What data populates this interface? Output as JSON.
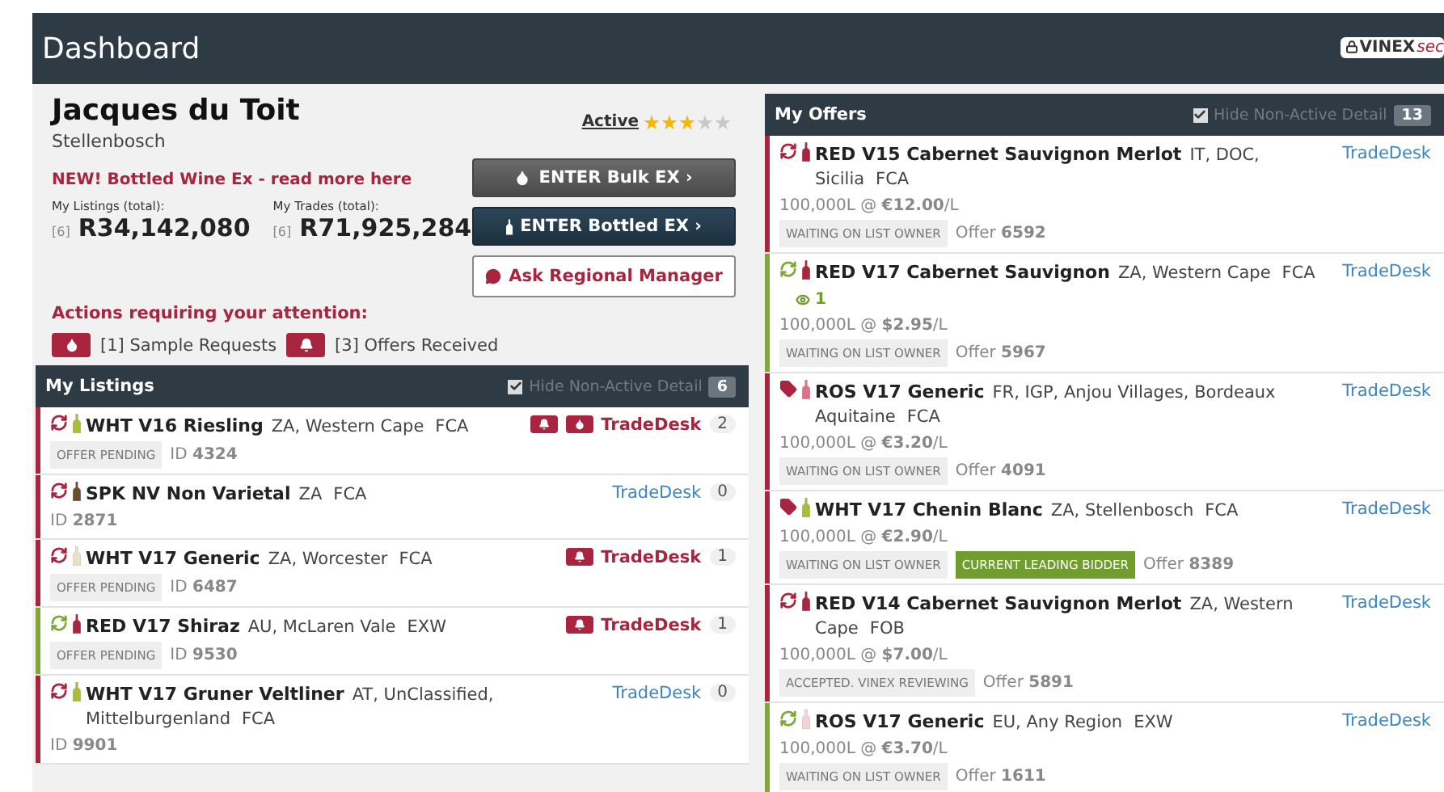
{
  "header": {
    "title": "Dashboard",
    "badge": {
      "brand": "VINEX",
      "suffix": "sec"
    }
  },
  "profile": {
    "name": "Jacques du Toit",
    "location": "Stellenbosch",
    "status": "Active",
    "stars": 3,
    "news": "NEW! Bottled Wine Ex - read more here",
    "stats": [
      {
        "label": "My Listings (total):",
        "count": "[6]",
        "value": "R34,142,080"
      },
      {
        "label": "My Trades (total):",
        "count": "[6]",
        "value": "R71,925,284"
      }
    ],
    "buttons": [
      {
        "kind": "bulk",
        "label": "ENTER Bulk EX ›"
      },
      {
        "kind": "bottled",
        "label": "ENTER Bottled EX ›"
      },
      {
        "kind": "ask",
        "label": "Ask Regional Manager"
      }
    ]
  },
  "actions": {
    "title": "Actions requiring your attention:",
    "items": [
      {
        "kind": "drop",
        "label": "[1] Sample Requests"
      },
      {
        "kind": "bell",
        "label": "[3] Offers Received"
      }
    ]
  },
  "listings": {
    "title": "My Listings",
    "hide_label": "Hide Non-Active Detail",
    "hide_non_active": true,
    "count": "6",
    "rows": [
      {
        "color": "#a8243f",
        "bottle": {
          "color": "#a9bd3a"
        },
        "title": "WHT V16 Riesling",
        "region": "ZA, Western Cape",
        "term": "FCA",
        "tag": "OFFER PENDING",
        "id": "ID **4324**",
        "alerts": [
          {
            "kind": "bell"
          },
          {
            "kind": "drop"
          }
        ],
        "link": "TradeDesk",
        "highlighted": true,
        "count": "2"
      },
      {
        "color": "#a8243f",
        "bottle": {
          "color": "#6b4a2e"
        },
        "title": "SPK NV Non Varietal",
        "region": "ZA",
        "term": "FCA",
        "id": "ID **2871**",
        "link": "TradeDesk",
        "highlighted": false,
        "count": "0"
      },
      {
        "color": "#a8243f",
        "bottle": {
          "color": "#e6e3c4"
        },
        "title": "WHT V17 Generic",
        "region": "ZA, Worcester",
        "term": "FCA",
        "tag": "OFFER PENDING",
        "id": "ID **6487**",
        "alerts": [
          {
            "kind": "bell"
          }
        ],
        "link": "TradeDesk",
        "highlighted": true,
        "count": "1"
      },
      {
        "color": "#7fa83a",
        "bottle": {
          "color": "#a8243f"
        },
        "title": "RED V17 Shiraz",
        "region": "AU, McLaren Vale",
        "term": "EXW",
        "tag": "OFFER PENDING",
        "id": "ID **9530**",
        "alerts": [
          {
            "kind": "bell"
          }
        ],
        "link": "TradeDesk",
        "highlighted": true,
        "count": "1"
      },
      {
        "color": "#a8243f",
        "bottle": {
          "color": "#a9bd3a"
        },
        "title": "WHT V17 Gruner Veltliner",
        "region": "AT, UnClassified, Mittelburgenland",
        "term": "FCA",
        "id": "ID **9901**",
        "link": "TradeDesk",
        "highlighted": false,
        "count": "0"
      }
    ]
  },
  "offers": {
    "title": "My Offers",
    "hide_label": "Hide Non-Active Detail",
    "hide_non_active": true,
    "count": "13",
    "rows": [
      {
        "kind": "sync",
        "color": "#a8243f",
        "bottle": {
          "color": "#a8243f"
        },
        "title": "RED V15 Cabernet Sauvignon Merlot",
        "region": "IT, DOC, Sicilia",
        "term": "FCA",
        "price": "100,000L @ **€12.00**/L",
        "tags": [
          {
            "kind": "status",
            "text": "WAITING ON LIST OWNER"
          }
        ],
        "offer": "Offer **6592**",
        "link": "TradeDesk"
      },
      {
        "kind": "sync",
        "color": "#7fa83a",
        "bottle": {
          "color": "#a8243f"
        },
        "title": "RED V17 Cabernet Sauvignon",
        "region": "ZA, Western Cape",
        "term": "FCA",
        "watchers": "1",
        "price": "100,000L @ **$2.95**/L",
        "tags": [
          {
            "kind": "status",
            "text": "WAITING ON LIST OWNER"
          }
        ],
        "offer": "Offer **5967**",
        "link": "TradeDesk"
      },
      {
        "kind": "tag",
        "color": "#a8243f",
        "bottle": {
          "color": "#e36f86"
        },
        "title": "ROS V17 Generic",
        "region": "FR, IGP, Anjou Villages, Bordeaux Aquitaine",
        "term": "FCA",
        "price": "100,000L @ **€3.20**/L",
        "tags": [
          {
            "kind": "status",
            "text": "WAITING ON LIST OWNER"
          }
        ],
        "offer": "Offer **4091**",
        "link": "TradeDesk"
      },
      {
        "kind": "tag",
        "color": "#a8243f",
        "bottle": {
          "color": "#a9bd3a"
        },
        "title": "WHT V17 Chenin Blanc",
        "region": "ZA, Stellenbosch",
        "term": "FCA",
        "price": "100,000L @ **€2.90**/L",
        "tags": [
          {
            "kind": "status",
            "text": "WAITING ON LIST OWNER"
          },
          {
            "kind": "leading",
            "text": "CURRENT LEADING BIDDER"
          }
        ],
        "offer": "Offer **8389**",
        "link": "TradeDesk"
      },
      {
        "kind": "sync",
        "color": "#a8243f",
        "bottle": {
          "color": "#a8243f"
        },
        "title": "RED V14 Cabernet Sauvignon Merlot",
        "region": "ZA, Western Cape",
        "term": "FOB",
        "price": "100,000L @ **$7.00**/L",
        "tags": [
          {
            "kind": "status",
            "text": "ACCEPTED. VINEX REVIEWING"
          }
        ],
        "offer": "Offer **5891**",
        "link": "TradeDesk"
      },
      {
        "kind": "sync",
        "color": "#7fa83a",
        "bottle": {
          "color": "#f2d2d8"
        },
        "title": "ROS V17 Generic",
        "region": "EU, Any Region",
        "term": "EXW",
        "price": "100,000L @ **€3.70**/L",
        "tags": [
          {
            "kind": "status",
            "text": "WAITING ON LIST OWNER"
          }
        ],
        "offer": "Offer **1611**",
        "link": "TradeDesk"
      }
    ]
  }
}
